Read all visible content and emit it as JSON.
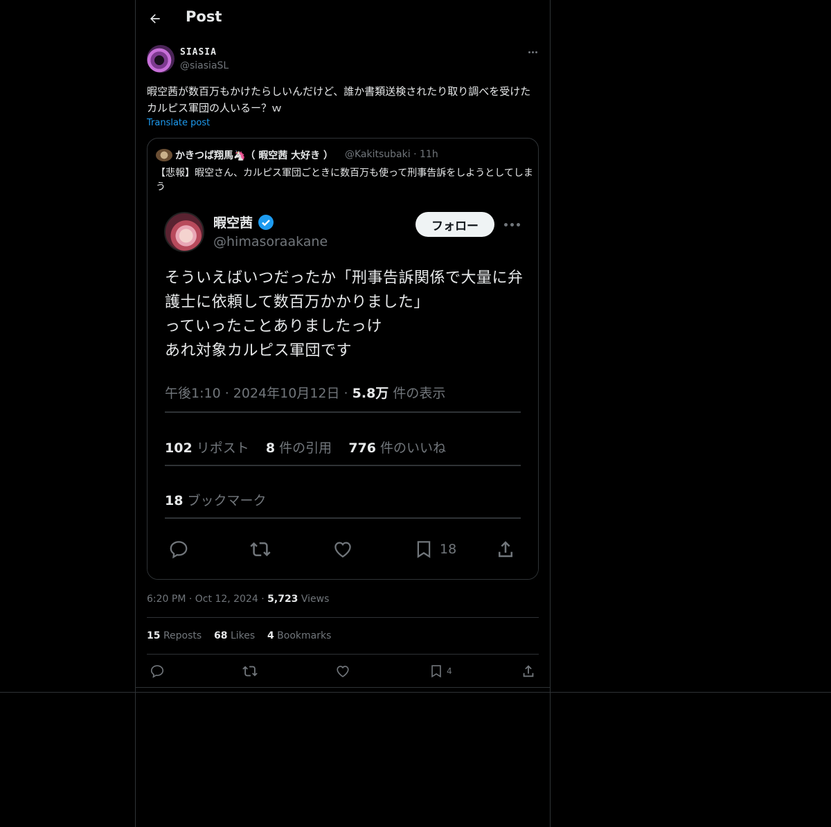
{
  "header": {
    "title": "Post"
  },
  "post": {
    "author_name": "SIASIA",
    "author_handle": "@siasiaSL",
    "text": "暇空茜が数百万もかけたらしいんだけど、誰か書類送検されたり取り調べを受けたカルピス軍団の人いるー？ｗ",
    "translate_label": "Translate post",
    "time": "6:20 PM",
    "date": "Oct 12, 2024",
    "views_count": "5,723",
    "views_label": "Views",
    "reposts_count": "15",
    "reposts_label": "Reposts",
    "likes_count": "68",
    "likes_label": "Likes",
    "bookmarks_count": "4",
    "bookmarks_label": "Bookmarks",
    "action_bookmark_count": "4"
  },
  "quote": {
    "author_name": "かきつば翔馬🦄（ 暇空茜 大好き ）",
    "author_handle": "@Kakitsubaki",
    "time": "11h",
    "text": "【悲報】暇空さん、カルピス軍団ごときに数百万も使って刑事告訴をしようとしてしまう",
    "screenshot": {
      "name": "暇空茜",
      "handle": "@himasoraakane",
      "follow_label": "フォロー",
      "text": "そういえばいつだったか「刑事告訴関係で大量に弁護士に依頼して数百万かかりました」\nっていったことありましたっけ\nあれ対象カルピス軍団です",
      "time_date": "午後1:10 · 2024年10月12日 · ",
      "views_count": "5.8万",
      "views_label": " 件の表示",
      "reposts_count": "102",
      "reposts_label": " リポスト",
      "quotes_count": "8",
      "quotes_label": " 件の引用",
      "likes_count": "776",
      "likes_label": " 件のいいね",
      "bookmarks_count": "18",
      "bookmarks_label": " ブックマーク",
      "action_bookmark_count": "18"
    }
  },
  "icons": [
    "back-arrow-icon",
    "more-icon",
    "verified-badge-icon",
    "reply-icon",
    "repost-icon",
    "like-icon",
    "bookmark-icon",
    "share-icon"
  ],
  "colors": {
    "background": "#000000",
    "text": "#e7e9ea",
    "muted": "#71767b",
    "border": "#2f3336",
    "link": "#1d9bf0",
    "verified": "#1d9bf0"
  }
}
